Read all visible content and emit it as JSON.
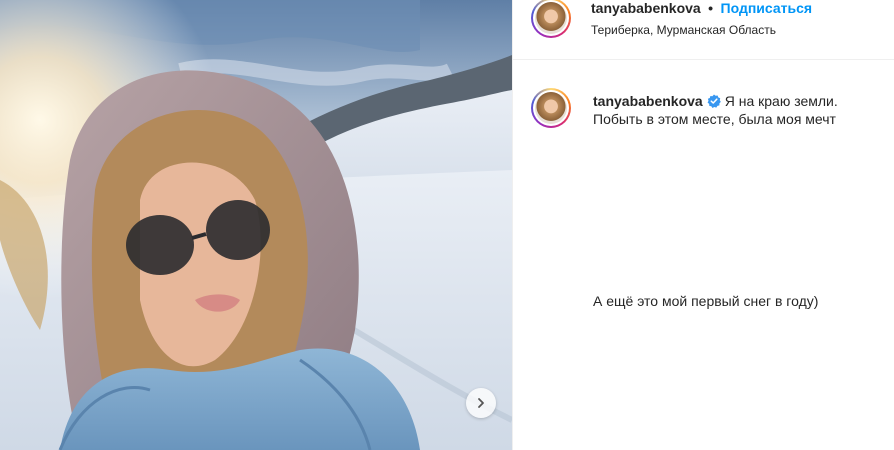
{
  "post": {
    "username": "tanyababenkova",
    "separator": "•",
    "follow_label": "Подписаться",
    "location": "Териберка, Мурманская Область"
  },
  "caption": {
    "username": "tanyababenkova",
    "line1": "Я на краю земли.",
    "line2": "Побыть в этом месте, была моя мечт",
    "line3": "А ещё это мой первый снег в году)"
  },
  "icons": {
    "next": "chevron-right-icon",
    "verified": "verified-badge-icon"
  },
  "colors": {
    "link": "#0095f6",
    "text": "#262626",
    "verified": "#3897f0"
  }
}
